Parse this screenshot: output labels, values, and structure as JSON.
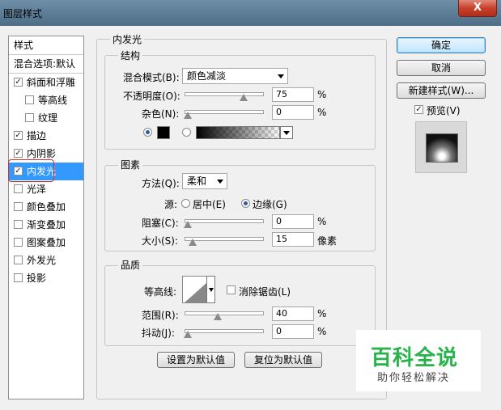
{
  "window": {
    "title": "图层样式",
    "close_label": "X"
  },
  "left_panel": {
    "header": "样式",
    "blend_options": "混合选项:默认",
    "items": [
      {
        "label": "斜面和浮雕",
        "checked": true
      },
      {
        "label": "等高线",
        "checked": false
      },
      {
        "label": "纹理",
        "checked": false
      },
      {
        "label": "描边",
        "checked": true
      },
      {
        "label": "内阴影",
        "checked": true
      },
      {
        "label": "内发光",
        "checked": true,
        "selected": true
      },
      {
        "label": "光泽",
        "checked": false
      },
      {
        "label": "颜色叠加",
        "checked": false
      },
      {
        "label": "渐变叠加",
        "checked": false
      },
      {
        "label": "图案叠加",
        "checked": false
      },
      {
        "label": "外发光",
        "checked": false
      },
      {
        "label": "投影",
        "checked": false
      }
    ]
  },
  "main": {
    "section_title": "内发光",
    "structure": {
      "title": "结构",
      "blend_mode_label": "混合模式(B):",
      "blend_mode_value": "颜色减淡",
      "opacity_label": "不透明度(O):",
      "opacity_value": "75",
      "opacity_unit": "%",
      "noise_label": "杂色(N):",
      "noise_value": "0",
      "noise_unit": "%",
      "color": "#000000"
    },
    "elements": {
      "title": "图素",
      "method_label": "方法(Q):",
      "method_value": "柔和",
      "source_label": "源:",
      "source_center": "居中(E)",
      "source_edge": "边缘(G)",
      "choke_label": "阻塞(C):",
      "choke_value": "0",
      "choke_unit": "%",
      "size_label": "大小(S):",
      "size_value": "15",
      "size_unit": "像素"
    },
    "quality": {
      "title": "品质",
      "contour_label": "等高线:",
      "antialias_label": "消除锯齿(L)",
      "range_label": "范围(R):",
      "range_value": "40",
      "range_unit": "%",
      "jitter_label": "抖动(J):",
      "jitter_value": "0",
      "jitter_unit": "%"
    },
    "set_default_button": "设置为默认值",
    "reset_default_button": "复位为默认值"
  },
  "right_panel": {
    "ok": "确定",
    "cancel": "取消",
    "new_style": "新建样式(W)...",
    "preview_label": "预览(V)",
    "preview_checked": true
  },
  "watermark": {
    "title": "百科全说",
    "subtitle": "助你轻松解决"
  },
  "slider_levels": {
    "opacity": 0.75,
    "noise": 0,
    "choke": 0,
    "size": 0.06,
    "range": 0.4,
    "jitter": 0
  }
}
